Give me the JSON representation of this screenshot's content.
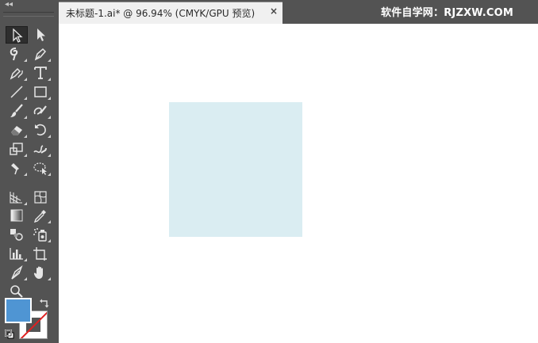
{
  "document": {
    "tab_title": "未标题-1.ai* @ 96.94% (CMYK/GPU 预览)",
    "close_glyph": "×"
  },
  "watermark": "软件自学网：RJZXW.COM",
  "toolbar": {
    "collapse_glyph": "◂◂",
    "tools": [
      {
        "id": "selection",
        "icon": "selection-arrow-icon",
        "active": true
      },
      {
        "id": "direct-selection",
        "icon": "direct-selection-arrow-icon"
      },
      {
        "id": "magic-wand",
        "icon": "magic-wand-icon"
      },
      {
        "id": "pen",
        "icon": "pen-icon"
      },
      {
        "id": "curvature",
        "icon": "curvature-pen-icon"
      },
      {
        "id": "type",
        "icon": "type-icon"
      },
      {
        "id": "line-segment",
        "icon": "line-segment-icon"
      },
      {
        "id": "rectangle",
        "icon": "rectangle-icon"
      },
      {
        "id": "paintbrush",
        "icon": "paintbrush-icon"
      },
      {
        "id": "shaper",
        "icon": "shaper-icon"
      },
      {
        "id": "eraser",
        "icon": "eraser-icon"
      },
      {
        "id": "rotate",
        "icon": "rotate-icon"
      },
      {
        "id": "scale",
        "icon": "scale-icon"
      },
      {
        "id": "warp",
        "icon": "warp-icon"
      },
      {
        "id": "puppet-warp",
        "icon": "puppet-warp-icon"
      },
      {
        "id": "free-transform",
        "icon": "free-transform-icon"
      },
      {
        "id": "perspective-grid",
        "icon": "perspective-grid-icon"
      },
      {
        "id": "mesh",
        "icon": "mesh-icon"
      },
      {
        "id": "gradient",
        "icon": "gradient-icon"
      },
      {
        "id": "eyedropper",
        "icon": "eyedropper-icon"
      },
      {
        "id": "blend",
        "icon": "blend-icon"
      },
      {
        "id": "symbol-sprayer",
        "icon": "symbol-sprayer-icon"
      },
      {
        "id": "column-graph",
        "icon": "column-graph-icon"
      },
      {
        "id": "artboard",
        "icon": "artboard-icon"
      },
      {
        "id": "slice",
        "icon": "slice-icon"
      },
      {
        "id": "hand",
        "icon": "hand-icon"
      },
      {
        "id": "zoom",
        "icon": "zoom-icon"
      }
    ]
  },
  "colors": {
    "fill": "#4f95d3",
    "stroke": "none",
    "shape_fill": "#daedf2",
    "canvas": "#ffffff",
    "ui_background": "#535353"
  }
}
